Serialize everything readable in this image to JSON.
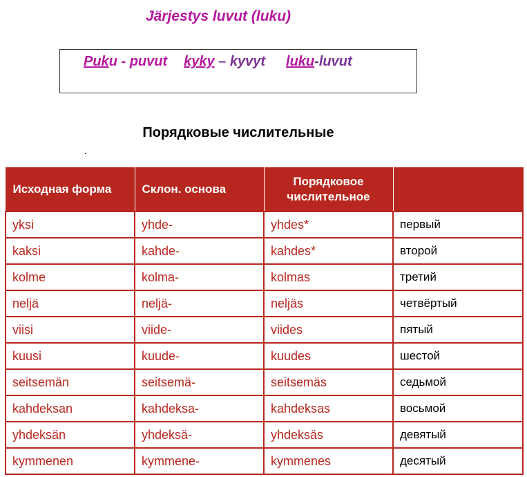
{
  "title": "Järjestys luvut (luku)",
  "examples": [
    {
      "stem": "Puk",
      "first_ending": "u",
      "separator": " - ",
      "plural": "puvut"
    },
    {
      "stem": "kyky",
      "first_ending": "",
      "separator": " – ",
      "plural": "kyvyt"
    },
    {
      "stem": "luku",
      "first_ending": "",
      "separator": "-",
      "plural": "luvut"
    }
  ],
  "section_title": "Порядковые числительные",
  "table": {
    "headers": [
      "Исходная форма",
      "Склон. основа",
      "Порядковое числительное",
      ""
    ],
    "rows": [
      [
        "yksi",
        "yhde-",
        "yhdes*",
        "первый"
      ],
      [
        "kaksi",
        "kahde-",
        "kahdes*",
        "второй"
      ],
      [
        "kolme",
        "kolma-",
        "kolmas",
        "третий"
      ],
      [
        "neljä",
        "neljä-",
        "neljäs",
        "четвёртый"
      ],
      [
        "viisi",
        "viide-",
        "viides",
        "пятый"
      ],
      [
        "kuusi",
        "kuude-",
        "kuudes",
        "шестой"
      ],
      [
        "seitsemän",
        "seitsemä-",
        "seitsemäs",
        "седьмой"
      ],
      [
        "kahdeksan",
        "kahdeksa-",
        "kahdeksas",
        "восьмой"
      ],
      [
        "yhdeksän",
        "yhdeksä-",
        "yhdeksäs",
        "девятый"
      ],
      [
        "kymmenen",
        "kymmene-",
        "kymmenes",
        "десятый"
      ]
    ]
  },
  "colors": {
    "magenta": "#b4179e",
    "purple": "#7a3296",
    "table_red": "#b8271f"
  }
}
